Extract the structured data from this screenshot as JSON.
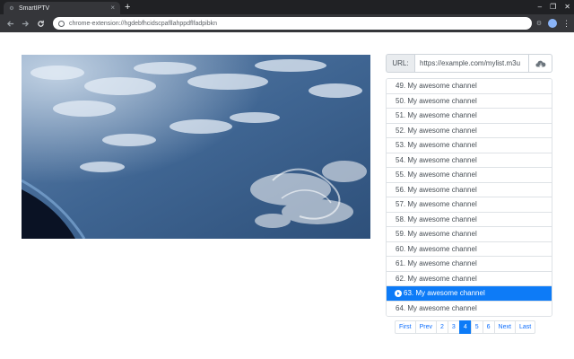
{
  "browser": {
    "tab_title": "SmartIPTV",
    "tab_close_glyph": "×",
    "new_tab_glyph": "+",
    "window_controls": [
      "–",
      "❐",
      "✕"
    ],
    "address": "chrome-extension://hgdebfhcidscpafllahppdflfadpibkn",
    "icons": [
      "back-icon",
      "forward-icon",
      "reload-icon",
      "extension-page-icon",
      "extension-icon",
      "avatar-icon",
      "menu-icon"
    ]
  },
  "player": {
    "url_label": "URL:",
    "url_value": "https://example.com/mylist.m3u",
    "load_icon": "cloud-download-icon"
  },
  "channels": [
    {
      "label": "49. My awesome channel",
      "active": false
    },
    {
      "label": "50. My awesome channel",
      "active": false
    },
    {
      "label": "51. My awesome channel",
      "active": false
    },
    {
      "label": "52. My awesome channel",
      "active": false
    },
    {
      "label": "53. My awesome channel",
      "active": false
    },
    {
      "label": "54. My awesome channel",
      "active": false
    },
    {
      "label": "55. My awesome channel",
      "active": false
    },
    {
      "label": "56. My awesome channel",
      "active": false
    },
    {
      "label": "57. My awesome channel",
      "active": false
    },
    {
      "label": "58. My awesome channel",
      "active": false
    },
    {
      "label": "59. My awesome channel",
      "active": false
    },
    {
      "label": "60. My awesome channel",
      "active": false
    },
    {
      "label": "61. My awesome channel",
      "active": false
    },
    {
      "label": "62. My awesome channel",
      "active": false
    },
    {
      "label": "63. My awesome channel",
      "active": true
    },
    {
      "label": "64. My awesome channel",
      "active": false
    }
  ],
  "pagination": [
    {
      "label": "First",
      "active": false
    },
    {
      "label": "Prev",
      "active": false
    },
    {
      "label": "2",
      "active": false
    },
    {
      "label": "3",
      "active": false
    },
    {
      "label": "4",
      "active": true
    },
    {
      "label": "5",
      "active": false
    },
    {
      "label": "6",
      "active": false
    },
    {
      "label": "Next",
      "active": false
    },
    {
      "label": "Last",
      "active": false
    }
  ],
  "colors": {
    "accent": "#0d7bf7",
    "chrome_dark": "#202124",
    "chrome_toolbar": "#35363a"
  }
}
